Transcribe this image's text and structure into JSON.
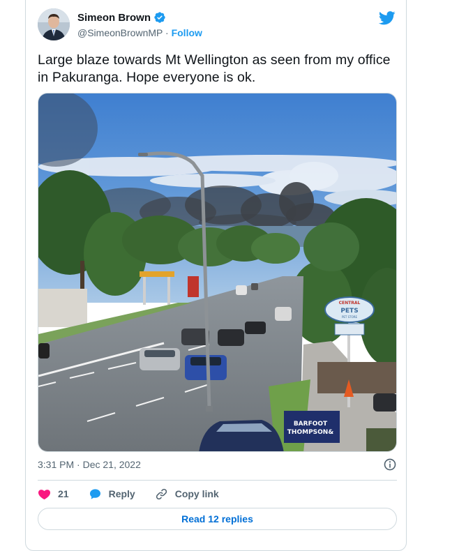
{
  "author": {
    "name": "Simeon Brown",
    "handle": "@SimeonBrownMP",
    "separator": "·",
    "follow_label": "Follow"
  },
  "tweet": {
    "text": "Large blaze towards Mt Wellington as seen from my office in Pakuranga. Hope everyone is ok.",
    "image": {
      "signs": {
        "central_pets_top": "CENTRAL",
        "central_pets_main": "PETS",
        "central_pets_sub": "PET STORE",
        "barfoot_line1": "BARFOOT",
        "barfoot_line2": "THOMPSON&"
      }
    },
    "time": "3:31 PM",
    "date_separator": "·",
    "date": "Dec 21, 2022"
  },
  "actions": {
    "likes": "21",
    "reply_label": "Reply",
    "copy_link_label": "Copy link"
  },
  "read_replies_label": "Read 12 replies",
  "colors": {
    "accent": "#1d9bf0",
    "like": "#f91880",
    "replies_link": "#006fd6"
  }
}
